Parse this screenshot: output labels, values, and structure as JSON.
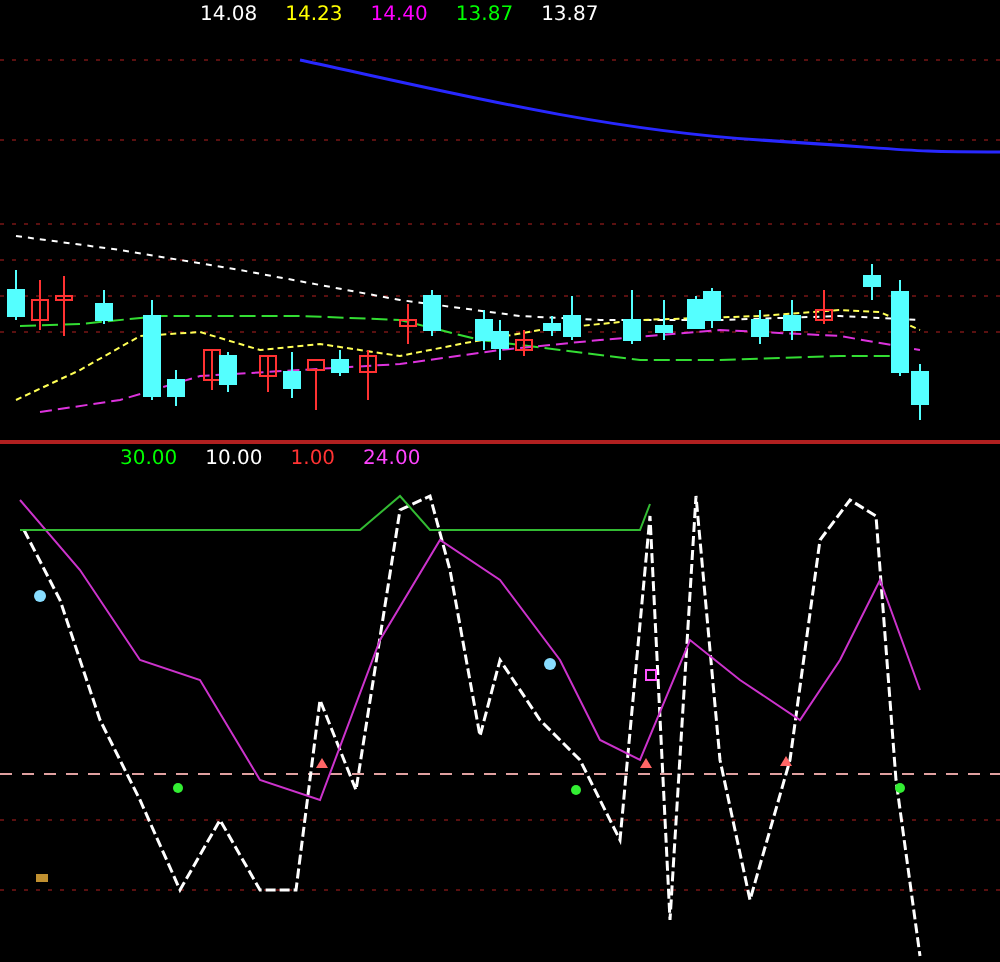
{
  "price_legend": [
    {
      "text": "14.08",
      "color": "#ffffff"
    },
    {
      "text": "14.23",
      "color": "#ffff00"
    },
    {
      "text": "14.40",
      "color": "#ff00ff"
    },
    {
      "text": "13.87",
      "color": "#00ff00"
    },
    {
      "text": "13.87",
      "color": "#ffffff"
    }
  ],
  "indicator_legend": [
    {
      "text": "30.00",
      "color": "#00ff00"
    },
    {
      "text": "10.00",
      "color": "#ffffff"
    },
    {
      "text": "1.00",
      "color": "#ff3333"
    },
    {
      "text": "24.00",
      "color": "#ff44ff"
    }
  ]
}
